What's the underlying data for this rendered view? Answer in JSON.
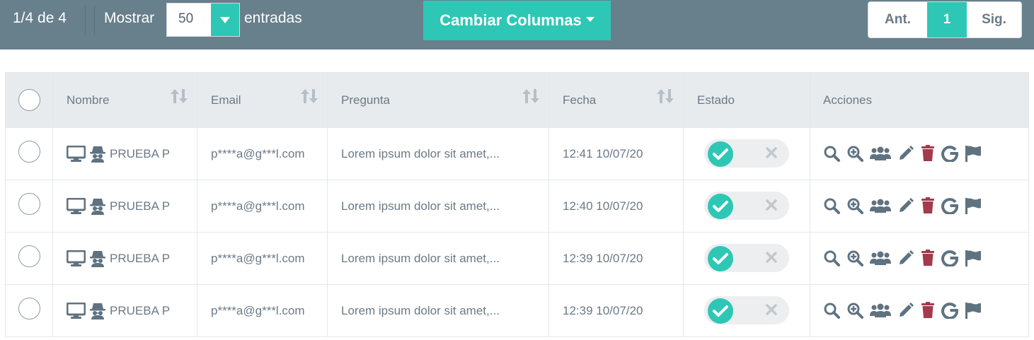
{
  "toolbar": {
    "info": "1/4 de 4",
    "show_label": "Mostrar",
    "page_size": "50",
    "entries_label": "entradas",
    "columns_button": "Cambiar Columnas",
    "pager": {
      "prev": "Ant.",
      "current": "1",
      "next": "Sig."
    }
  },
  "table": {
    "headers": {
      "nombre": "Nombre",
      "email": "Email",
      "pregunta": "Pregunta",
      "fecha": "Fecha",
      "estado": "Estado",
      "acciones": "Acciones"
    },
    "rows": [
      {
        "nombre": "PRUEBA P",
        "email": "p****a@g***l.com",
        "pregunta": "Lorem ipsum dolor sit amet,...",
        "fecha": "12:41 10/07/20",
        "estado": true
      },
      {
        "nombre": "PRUEBA P",
        "email": "p****a@g***l.com",
        "pregunta": "Lorem ipsum dolor sit amet,...",
        "fecha": "12:40 10/07/20",
        "estado": true
      },
      {
        "nombre": "PRUEBA P",
        "email": "p****a@g***l.com",
        "pregunta": "Lorem ipsum dolor sit amet,...",
        "fecha": "12:39 10/07/20",
        "estado": true
      },
      {
        "nombre": "PRUEBA P",
        "email": "p****a@g***l.com",
        "pregunta": "Lorem ipsum dolor sit amet,...",
        "fecha": "12:39 10/07/20",
        "estado": true
      }
    ]
  },
  "icons": {
    "row_source": "desktop-icon",
    "row_user": "incognito-icon",
    "actions": [
      "search-icon",
      "zoom-in-icon",
      "users-icon",
      "edit-icon",
      "trash-icon",
      "google-icon",
      "flag-icon"
    ]
  },
  "colors": {
    "toolbar_bg": "#687f8c",
    "accent": "#2ec7b5",
    "text": "#6c7a86",
    "danger": "#a33b4b",
    "header_bg": "#e8ebee"
  }
}
